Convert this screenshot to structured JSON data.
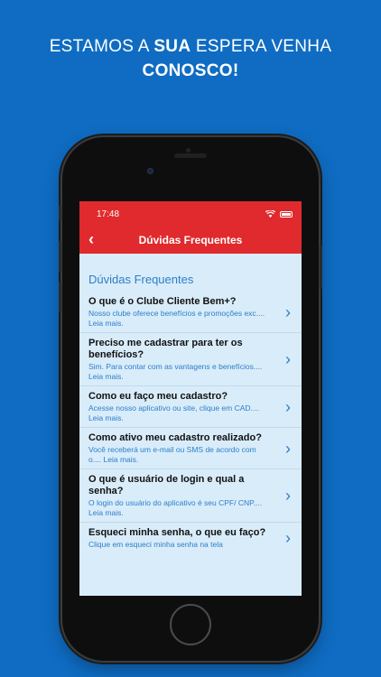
{
  "headline": {
    "line1_pre": "ESTAMOS A ",
    "line1_bold": "SUA",
    "line1_post": " ESPERA VENHA",
    "line2_bold": "CONOSCO!"
  },
  "status_bar": {
    "time": "17:48",
    "wifi_icon": "wifi-icon",
    "battery_icon": "battery-icon"
  },
  "nav": {
    "back_icon": "chevron-left-icon",
    "title": "Dúvidas Frequentes"
  },
  "section_title": "Dúvidas Frequentes",
  "faq_items": [
    {
      "question": "O que é o Clube Cliente Bem+?",
      "answer": "Nosso clube oferece benefícios e promoções exc....  Leia mais."
    },
    {
      "question": "Preciso me cadastrar para ter os benefícios?",
      "answer": "Sim. Para contar com as vantagens e benefícios....  Leia mais."
    },
    {
      "question": "Como eu faço meu cadastro?",
      "answer": "Acesse nosso aplicativo ou site, clique em CAD....  Leia mais."
    },
    {
      "question": "Como ativo meu cadastro realizado?",
      "answer": "Você receberá um e-mail ou SMS de acordo com o....  Leia mais."
    },
    {
      "question": "O que é usuário de login e qual a senha?",
      "answer": "O login do usuário do aplicativo é seu CPF/ CNP....  Leia mais."
    },
    {
      "question": "Esqueci minha senha, o que eu faço?",
      "answer": "Clique em esqueci minha senha na tela"
    }
  ],
  "colors": {
    "background": "#0f6cc2",
    "header_red": "#e02a2d",
    "accent_blue": "#2c7fc7",
    "screen_bg": "#d9ecfa"
  }
}
